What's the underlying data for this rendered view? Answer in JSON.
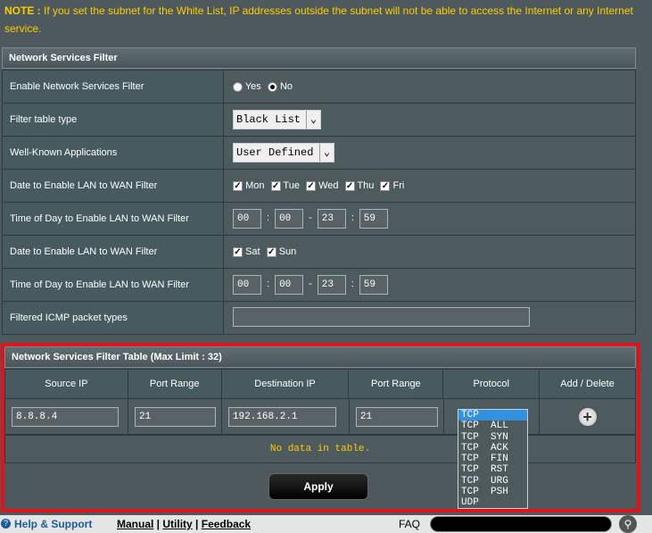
{
  "note": {
    "label": "NOTE :",
    "text": " If you set the subnet for the White List, IP addresses outside the subnet will not be able to access the Internet or any Internet service."
  },
  "filter_panel": {
    "title": "Network Services Filter",
    "rows": {
      "enable_label": "Enable Network Services Filter",
      "yes": "Yes",
      "no": "No",
      "type_label": "Filter table type",
      "type_value": "Black List",
      "apps_label": "Well-Known Applications",
      "apps_value": "User Defined",
      "date1_label": "Date to Enable LAN to WAN Filter",
      "mon": "Mon",
      "tue": "Tue",
      "wed": "Wed",
      "thu": "Thu",
      "fri": "Fri",
      "time1_label": "Time of Day to Enable LAN to WAN Filter",
      "t1_h1": "00",
      "t1_m1": "00",
      "t1_h2": "23",
      "t1_m2": "59",
      "date2_label": "Date to Enable LAN to WAN Filter",
      "sat": "Sat",
      "sun": "Sun",
      "time2_label": "Time of Day to Enable LAN to WAN Filter",
      "t2_h1": "00",
      "t2_m1": "00",
      "t2_h2": "23",
      "t2_m2": "59",
      "icmp_label": "Filtered ICMP packet types",
      "icmp_value": ""
    }
  },
  "filter_table": {
    "title": "Network Services Filter Table (Max Limit : 32)",
    "headers": [
      "Source IP",
      "Port Range",
      "Destination IP",
      "Port Range",
      "Protocol",
      "Add / Delete"
    ],
    "source_ip": "8.8.8.4",
    "src_port": "21",
    "dest_ip": "192.168.2.1",
    "dst_port": "21",
    "protocol_options": [
      "TCP",
      "TCP  ALL",
      "TCP  SYN",
      "TCP  ACK",
      "TCP  FIN",
      "TCP  RST",
      "TCP  URG",
      "TCP  PSH",
      "UDP"
    ],
    "no_data": "No data in table."
  },
  "apply_label": "Apply",
  "footer": {
    "help": "Help & Support",
    "manual": "Manual",
    "utility": "Utility",
    "feedback": "Feedback",
    "faq": "FAQ"
  }
}
